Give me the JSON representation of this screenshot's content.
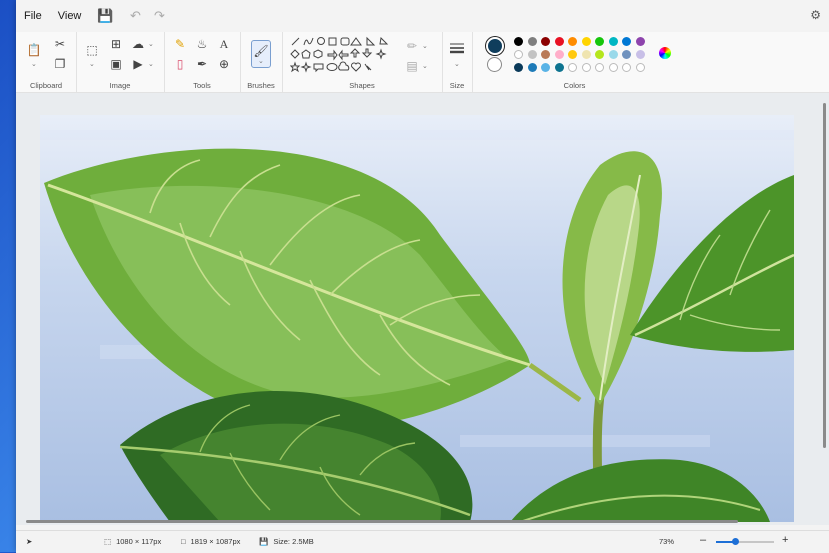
{
  "menu": {
    "file": "File",
    "view": "View"
  },
  "ribbon": {
    "groups": {
      "clipboard": "Clipboard",
      "image": "Image",
      "tools": "Tools",
      "brushes": "Brushes",
      "shapes": "Shapes",
      "size": "Size",
      "colors": "Colors"
    },
    "color1": "#0f3d5c",
    "color2": "#ffffff",
    "palette_row1": [
      "#000000",
      "#7f7f7f",
      "#8b0000",
      "#e81123",
      "#ff8c00",
      "#ffd400",
      "#16c60c",
      "#00b7c3",
      "#0078d4",
      "#8e44ad"
    ],
    "palette_row2": [
      "#ffffff",
      "#c3c3c3",
      "#b97a57",
      "#ffaec9",
      "#ffc90e",
      "#efe4b0",
      "#b5e61d",
      "#99d9ea",
      "#7092be",
      "#c8bfe7"
    ],
    "palette_row3": [
      "#0b3a5a",
      "#1e7bb8",
      "#59b3e6",
      "#0e7490"
    ]
  },
  "status": {
    "cursor": "1080 × 117px",
    "selection": "1819 × 1087px",
    "size": "Size: 2.5MB",
    "zoom": "73%",
    "zoom_level": 0.73
  }
}
